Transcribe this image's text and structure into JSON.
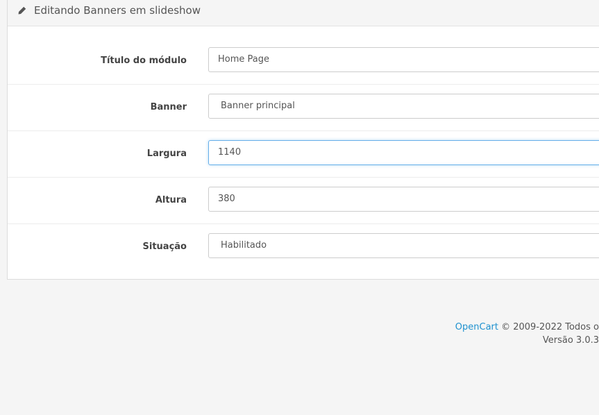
{
  "panel": {
    "title": "Editando Banners em slideshow",
    "icon": "pencil-icon"
  },
  "form": {
    "title_label": "Título do módulo",
    "title_value": "Home Page",
    "banner_label": "Banner",
    "banner_value": "Banner principal",
    "width_label": "Largura",
    "width_value": "1140",
    "height_label": "Altura",
    "height_value": "380",
    "status_label": "Situação",
    "status_value": "Habilitado"
  },
  "footer": {
    "brand": "OpenCart",
    "copyright": " © 2009-2022 Todos o",
    "version": "Versão 3.0.3"
  },
  "colors": {
    "link": "#1e91cf",
    "focus_border": "#66afe9",
    "background": "#f5f5f5"
  }
}
